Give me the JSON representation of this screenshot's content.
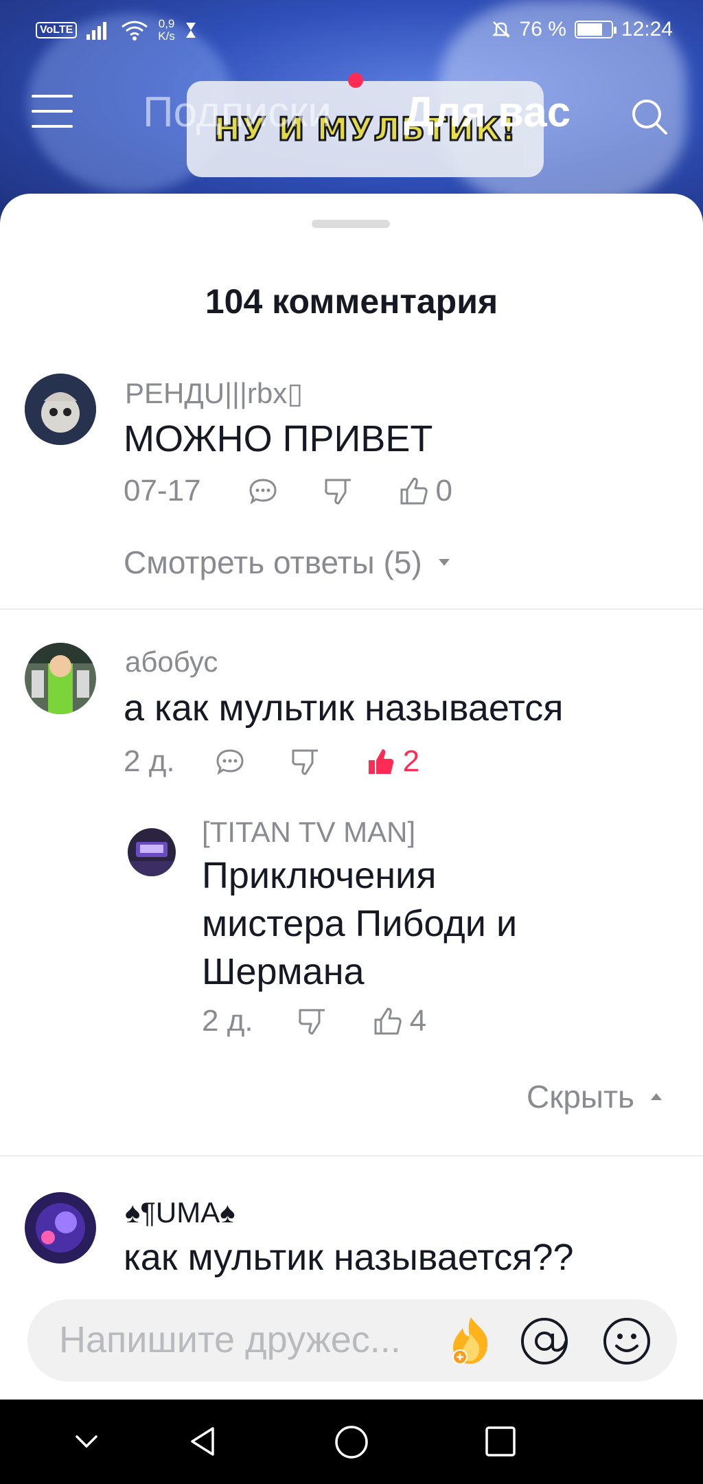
{
  "status_bar": {
    "volte": "VoLTE",
    "net_speed_value": "0,9",
    "net_speed_unit": "K/s",
    "battery": "76 %",
    "battery_level": 0.76,
    "time": "12:24"
  },
  "top_nav": {
    "tab_subscriptions": "Подписки",
    "tab_for_you": "Для вас"
  },
  "video": {
    "sign_text": "НУ И МУЛЬТИК!"
  },
  "sheet": {
    "title": "104 комментария"
  },
  "comments": [
    {
      "username": "РЕНДU|||rbx▯",
      "text": "МОЖНО ПРИВЕТ",
      "date": "07-17",
      "likes": "0",
      "view_replies": "Смотреть ответы (5)"
    },
    {
      "username": "абобус",
      "text": "а как мультик называется",
      "date": "2 д.",
      "likes": "2",
      "replies": [
        {
          "username": "[TITAN TV MAN]",
          "text_lines": [
            "Приключения",
            "мистера Пибоди и",
            "Шермана"
          ],
          "date": "2 д.",
          "likes": "4"
        }
      ],
      "hide_label": "Скрыть"
    },
    {
      "username": "♠¶UMA♠",
      "text": "как мультик называется??"
    }
  ],
  "input": {
    "placeholder": "Напишите дружес..."
  },
  "colors": {
    "accent": "#fe2c55",
    "text_primary": "#161823",
    "text_secondary": "#8a8b91"
  }
}
